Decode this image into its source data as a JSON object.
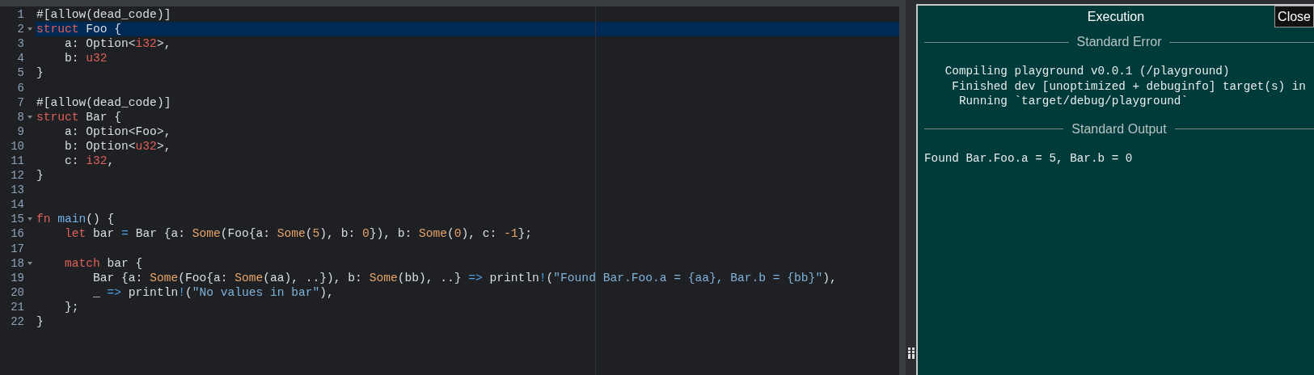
{
  "editor": {
    "lines": [
      {
        "number": "1",
        "foldable": false,
        "active": false,
        "tokens": [
          {
            "text": "#[allow(dead_code)]",
            "kind": "text"
          }
        ]
      },
      {
        "number": "2",
        "foldable": true,
        "active": true,
        "tokens": [
          {
            "text": "struct",
            "kind": "kw"
          },
          {
            "text": " Foo {",
            "kind": "text"
          }
        ]
      },
      {
        "number": "3",
        "foldable": false,
        "active": false,
        "tokens": [
          {
            "text": "    a: Option<",
            "kind": "text"
          },
          {
            "text": "i32",
            "kind": "kw"
          },
          {
            "text": ">,",
            "kind": "text"
          }
        ]
      },
      {
        "number": "4",
        "foldable": false,
        "active": false,
        "tokens": [
          {
            "text": "    b: ",
            "kind": "text"
          },
          {
            "text": "u32",
            "kind": "kw"
          }
        ]
      },
      {
        "number": "5",
        "foldable": false,
        "active": false,
        "tokens": [
          {
            "text": "}",
            "kind": "text"
          }
        ]
      },
      {
        "number": "6",
        "foldable": false,
        "active": false
      },
      {
        "number": "7",
        "foldable": false,
        "active": false,
        "tokens": [
          {
            "text": "#[allow(dead_code)]",
            "kind": "text"
          }
        ]
      },
      {
        "number": "8",
        "foldable": true,
        "active": false,
        "tokens": [
          {
            "text": "struct",
            "kind": "kw"
          },
          {
            "text": " Bar {",
            "kind": "text"
          }
        ]
      },
      {
        "number": "9",
        "foldable": false,
        "active": false,
        "tokens": [
          {
            "text": "    a: Option<Foo>,",
            "kind": "text"
          }
        ]
      },
      {
        "number": "10",
        "foldable": false,
        "active": false,
        "tokens": [
          {
            "text": "    b: Option<",
            "kind": "text"
          },
          {
            "text": "u32",
            "kind": "kw"
          },
          {
            "text": ">,",
            "kind": "text"
          }
        ]
      },
      {
        "number": "11",
        "foldable": false,
        "active": false,
        "tokens": [
          {
            "text": "    c: ",
            "kind": "text"
          },
          {
            "text": "i32",
            "kind": "kw"
          },
          {
            "text": ",",
            "kind": "text"
          }
        ]
      },
      {
        "number": "12",
        "foldable": false,
        "active": false,
        "tokens": [
          {
            "text": "}",
            "kind": "text"
          }
        ]
      },
      {
        "number": "13",
        "foldable": false,
        "active": false
      },
      {
        "number": "14",
        "foldable": false,
        "active": false
      },
      {
        "number": "15",
        "foldable": true,
        "active": false,
        "tokens": [
          {
            "text": "fn",
            "kind": "kw"
          },
          {
            "text": " main",
            "kind": "fn"
          },
          {
            "text": "() {",
            "kind": "text"
          }
        ]
      },
      {
        "number": "16",
        "foldable": false,
        "active": false,
        "tokens": [
          {
            "text": "    let",
            "kind": "kw"
          },
          {
            "text": " bar ",
            "kind": "text"
          },
          {
            "text": "=",
            "kind": "op"
          },
          {
            "text": " Bar {a: ",
            "kind": "text"
          },
          {
            "text": "Some",
            "kind": "call"
          },
          {
            "text": "(Foo{a: ",
            "kind": "text"
          },
          {
            "text": "Some",
            "kind": "call"
          },
          {
            "text": "(",
            "kind": "text"
          },
          {
            "text": "5",
            "kind": "num"
          },
          {
            "text": "), b: ",
            "kind": "text"
          },
          {
            "text": "0",
            "kind": "num"
          },
          {
            "text": "}), b: ",
            "kind": "text"
          },
          {
            "text": "Some",
            "kind": "call"
          },
          {
            "text": "(",
            "kind": "text"
          },
          {
            "text": "0",
            "kind": "num"
          },
          {
            "text": "), c: ",
            "kind": "text"
          },
          {
            "text": "-1",
            "kind": "num"
          },
          {
            "text": "};",
            "kind": "text"
          }
        ]
      },
      {
        "number": "17",
        "foldable": false,
        "active": false
      },
      {
        "number": "18",
        "foldable": true,
        "active": false,
        "tokens": [
          {
            "text": "    match",
            "kind": "kw"
          },
          {
            "text": " bar {",
            "kind": "text"
          }
        ]
      },
      {
        "number": "19",
        "foldable": false,
        "active": false,
        "tokens": [
          {
            "text": "        Bar {a: ",
            "kind": "text"
          },
          {
            "text": "Some",
            "kind": "call"
          },
          {
            "text": "(Foo{a: ",
            "kind": "text"
          },
          {
            "text": "Some",
            "kind": "call"
          },
          {
            "text": "(aa), ..}), b: ",
            "kind": "text"
          },
          {
            "text": "Some",
            "kind": "call"
          },
          {
            "text": "(bb), ..} ",
            "kind": "text"
          },
          {
            "text": "=>",
            "kind": "op"
          },
          {
            "text": " println",
            "kind": "text"
          },
          {
            "text": "!",
            "kind": "op"
          },
          {
            "text": "(",
            "kind": "text"
          },
          {
            "text": "\"Found Bar.Foo.a = {aa}, Bar.b = {bb}\"",
            "kind": "str"
          },
          {
            "text": "),",
            "kind": "text"
          }
        ]
      },
      {
        "number": "20",
        "foldable": false,
        "active": false,
        "tokens": [
          {
            "text": "        _ ",
            "kind": "text"
          },
          {
            "text": "=>",
            "kind": "op"
          },
          {
            "text": " println",
            "kind": "text"
          },
          {
            "text": "!",
            "kind": "op"
          },
          {
            "text": "(",
            "kind": "text"
          },
          {
            "text": "\"No values in bar\"",
            "kind": "str"
          },
          {
            "text": "),",
            "kind": "text"
          }
        ]
      },
      {
        "number": "21",
        "foldable": false,
        "active": false,
        "tokens": [
          {
            "text": "    };",
            "kind": "text"
          }
        ]
      },
      {
        "number": "22",
        "foldable": false,
        "active": false,
        "tokens": [
          {
            "text": "}",
            "kind": "text"
          }
        ]
      }
    ]
  },
  "execution": {
    "title": "Execution",
    "close_button": "Close",
    "sections": [
      {
        "heading": "Standard Error",
        "lines": [
          "   Compiling playground v0.0.1 (/playground)",
          "    Finished dev [unoptimized + debuginfo] target(s) in",
          "     Running `target/debug/playground`"
        ]
      },
      {
        "heading": "Standard Output",
        "lines": [
          "Found Bar.Foo.a = 5, Bar.b = 0"
        ]
      }
    ]
  }
}
